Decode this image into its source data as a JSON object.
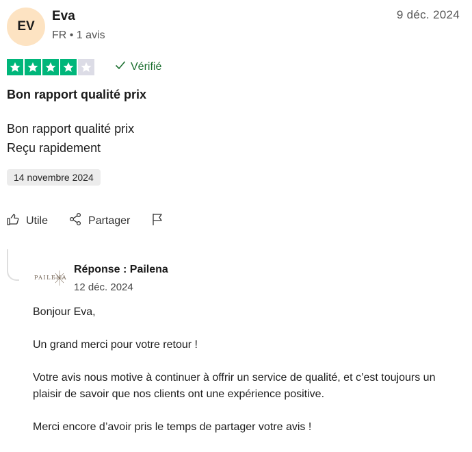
{
  "review": {
    "avatar_initials": "EV",
    "author": "Eva",
    "meta": "FR • 1 avis",
    "date": "9 déc. 2024",
    "rating": 4,
    "rating_max": 5,
    "star_color": "#00b67a",
    "verified_label": "Vérifié",
    "title": "Bon rapport qualité prix",
    "body_lines": [
      "Bon rapport qualité prix",
      "Reçu rapidement"
    ],
    "experience_date": "14 novembre 2024"
  },
  "actions": {
    "useful_label": "Utile",
    "share_label": "Partager"
  },
  "reply": {
    "logo_text": "PAILENA",
    "title": "Réponse : Pailena",
    "date": "12 déc. 2024",
    "paragraphs": [
      "Bonjour Eva,",
      "Un grand merci pour votre retour !",
      "Votre avis nous motive à continuer à offrir un service de qualité, et c’est toujours un plaisir de savoir que nos clients ont une expérience positive.",
      "Merci encore d’avoir pris le temps de partager votre avis !"
    ]
  }
}
